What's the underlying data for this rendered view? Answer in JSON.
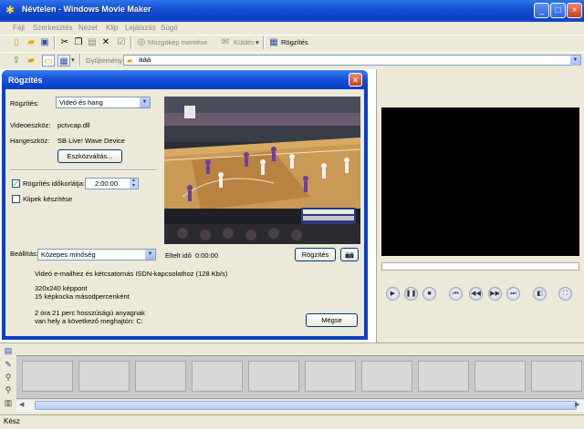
{
  "window": {
    "title": "Névtelen - Windows Movie Maker"
  },
  "menu": [
    "Fájl",
    "Szerkesztés",
    "Nézet",
    "Klip",
    "Lejátszás",
    "Súgó"
  ],
  "toolbar": {
    "save_movie_label": "Mozgókép mentése",
    "send_label": "Küldés",
    "record_label": "Rögzítés"
  },
  "collection": {
    "label": "Gyűjtemény",
    "value": "aaa"
  },
  "dialog": {
    "title": "Rögzítés",
    "record_label": "Rögzítés:",
    "record_value": "Videó és hang",
    "video_device_label": "Videoeszköz:",
    "video_device_value": "pctvcap.dll",
    "audio_device_label": "Hangeszköz:",
    "audio_device_value": "SB Live! Wave Device",
    "change_device_button": "Eszközváltás...",
    "time_limit_label": "Rögzítés időkorlátja:",
    "time_limit_value": "2:00:00",
    "take_photos_label": "Klipek készítése",
    "elapsed_label": "Eltelt idő",
    "elapsed_value": "0:00:00",
    "record_button": "Rögzítés",
    "setting_label": "Beállítás:",
    "setting_value": "Közepes minőség",
    "desc_line1": "Videó e-mailhez és kétcsatornás ISDN-kapcsolathoz (128 Kb/s)",
    "desc_line2": "320x240 képpont",
    "desc_line3": "15 képkocka másodpercenként",
    "desc_line4": "2 óra 21 perc hosszúságú anyagnak",
    "desc_line5": "van hely a következő meghajtón: C:",
    "cancel_button": "Mégse"
  },
  "status": {
    "text": "Kész"
  }
}
